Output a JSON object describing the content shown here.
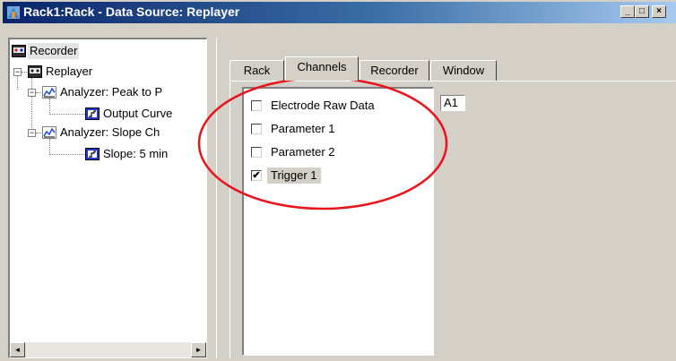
{
  "window": {
    "title": "Rack1:Rack - Data Source: Replayer",
    "controls": [
      "minimize",
      "maximize",
      "close"
    ],
    "minimize_glyph": "_",
    "maximize_glyph": "□",
    "close_glyph": "×"
  },
  "tree": {
    "items": [
      {
        "label": "Recorder",
        "icon": "recorder-icon"
      },
      {
        "label": "Replayer",
        "icon": "replayer-icon",
        "expanded": true
      },
      {
        "label": "Analyzer: Peak to P",
        "icon": "analyzer-icon",
        "expanded": true
      },
      {
        "label": "Output Curve",
        "icon": "output-icon"
      },
      {
        "label": "Analyzer: Slope Ch",
        "icon": "analyzer-icon",
        "expanded": true
      },
      {
        "label": "Slope: 5 min",
        "icon": "output-icon"
      }
    ],
    "collapse_glyph": "−",
    "scroll_left": "◄",
    "scroll_right": "►"
  },
  "tabs": [
    {
      "label": "Rack",
      "active": false
    },
    {
      "label": "Channels",
      "active": true
    },
    {
      "label": "Recorder",
      "active": false
    },
    {
      "label": "Window",
      "active": false
    }
  ],
  "channels": {
    "items": [
      {
        "label": "Electrode Raw Data",
        "checked": false
      },
      {
        "label": "Parameter 1",
        "checked": false
      },
      {
        "label": "Parameter 2",
        "checked": false
      },
      {
        "label": "Trigger 1",
        "checked": true
      }
    ],
    "check_glyph": "✔",
    "channel_name": "A1"
  },
  "colors": {
    "annotation_ellipse": "#e8141c",
    "titlebar_start": "#0a246a",
    "titlebar_end": "#a6caf0",
    "face": "#d4d0c8"
  }
}
